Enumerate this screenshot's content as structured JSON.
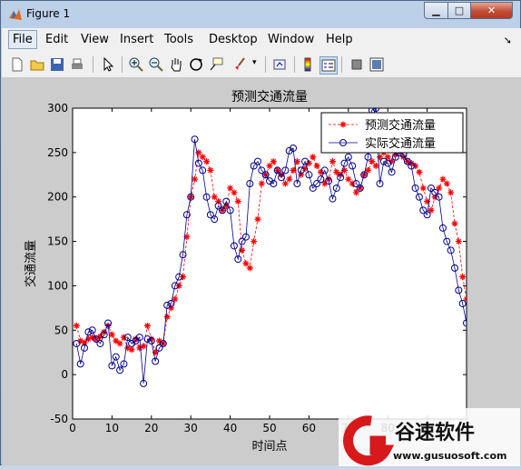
{
  "window": {
    "title": "Figure 1"
  },
  "menu": [
    "File",
    "Edit",
    "View",
    "Insert",
    "Tools",
    "Desktop",
    "Window",
    "Help"
  ],
  "toolbar_icons": [
    "new-file-icon",
    "open-folder-icon",
    "save-icon",
    "print-icon",
    "pointer-icon",
    "zoom-in-icon",
    "zoom-out-icon",
    "pan-hand-icon",
    "rotate-3d-icon",
    "data-cursor-icon",
    "brush-icon",
    "link-plot-icon",
    "colorbar-icon",
    "legend-icon",
    "hide-plot-tools-icon",
    "show-plot-tools-icon"
  ],
  "chart_data": {
    "type": "line",
    "title": "预测交通流量",
    "xlabel": "时间点",
    "ylabel": "交通流量",
    "xlim": [
      0,
      100
    ],
    "ylim": [
      -50,
      300
    ],
    "xticks": [
      "0",
      "10",
      "20",
      "30",
      "40",
      "50",
      "60",
      "70",
      "80",
      "90"
    ],
    "yticks": [
      "-50",
      "0",
      "50",
      "100",
      "150",
      "200",
      "250",
      "300"
    ],
    "legend_position": "top-right",
    "series": [
      {
        "name": "预测交通流量",
        "color": "#ff0000",
        "marker": "star",
        "line": "dashed",
        "values": [
          55,
          38,
          36,
          40,
          42,
          40,
          43,
          48,
          55,
          45,
          38,
          35,
          42,
          30,
          28,
          40,
          30,
          32,
          55,
          40,
          25,
          38,
          35,
          65,
          75,
          85,
          100,
          110,
          155,
          200,
          220,
          250,
          245,
          240,
          230,
          200,
          195,
          185,
          190,
          210,
          205,
          195,
          140,
          125,
          120,
          150,
          175,
          215,
          225,
          235,
          240,
          230,
          225,
          215,
          220,
          230,
          240,
          225,
          232,
          238,
          245,
          235,
          228,
          215,
          220,
          240,
          228,
          225,
          230,
          220,
          215,
          205,
          210,
          225,
          230,
          240,
          235,
          245,
          250,
          245,
          240,
          248,
          252,
          245,
          240,
          238,
          235,
          228,
          210,
          195,
          185,
          200,
          210,
          220,
          215,
          205,
          170,
          150,
          110,
          85,
          75,
          80,
          62
        ]
      },
      {
        "name": "实际交通流量",
        "color": "#00008b",
        "marker": "circle",
        "line": "solid",
        "values": [
          35,
          12,
          30,
          48,
          50,
          40,
          35,
          45,
          58,
          10,
          20,
          5,
          12,
          42,
          35,
          38,
          42,
          -10,
          40,
          38,
          15,
          30,
          35,
          78,
          80,
          100,
          110,
          135,
          180,
          200,
          265,
          238,
          230,
          200,
          180,
          175,
          190,
          185,
          195,
          185,
          145,
          130,
          150,
          155,
          215,
          235,
          240,
          230,
          225,
          218,
          215,
          230,
          222,
          230,
          252,
          255,
          215,
          230,
          240,
          225,
          210,
          215,
          220,
          230,
          218,
          198,
          210,
          222,
          238,
          245,
          235,
          215,
          210,
          225,
          245,
          298,
          300,
          215,
          240,
          238,
          228,
          245,
          250,
          248,
          240,
          235,
          210,
          200,
          185,
          180,
          210,
          205,
          200,
          165,
          150,
          140,
          120,
          95,
          80,
          58,
          85
        ]
      }
    ]
  },
  "watermark": {
    "brand": "谷速软件",
    "url": "www.gusuosoft.com"
  }
}
